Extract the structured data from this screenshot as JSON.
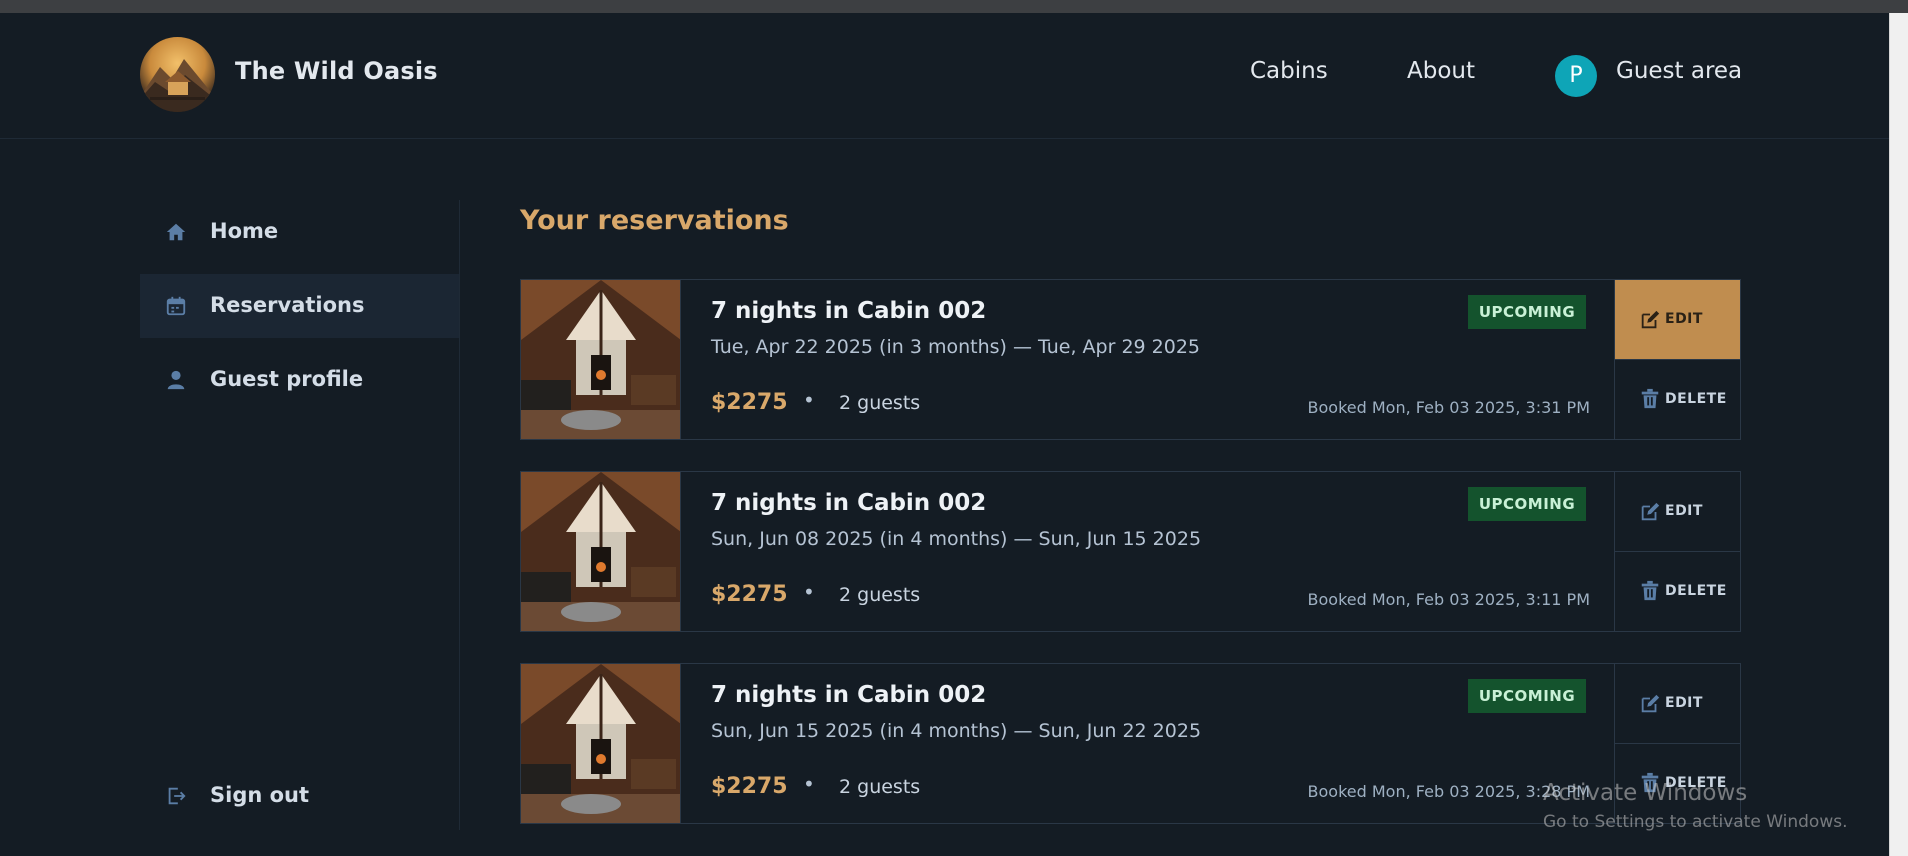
{
  "header": {
    "brand": "The Wild Oasis",
    "nav": {
      "cabins": "Cabins",
      "about": "About",
      "guest_area": "Guest area"
    },
    "avatar_initial": "P"
  },
  "sidebar": {
    "items": [
      {
        "label": "Home",
        "icon": "home-icon"
      },
      {
        "label": "Reservations",
        "icon": "calendar-icon",
        "active": true
      },
      {
        "label": "Guest profile",
        "icon": "user-icon"
      }
    ],
    "sign_out": {
      "label": "Sign out",
      "icon": "sign-out-icon"
    }
  },
  "main": {
    "title": "Your reservations",
    "reservations": [
      {
        "title": "7 nights in Cabin 002",
        "dates": "Tue, Apr 22 2025 (in 3 months) — Tue, Apr 29 2025",
        "price": "$2275",
        "separator": "•",
        "guests": "2 guests",
        "booked": "Booked Mon, Feb 03 2025, 3:31 PM",
        "status": "UPCOMING",
        "edit_label": "EDIT",
        "delete_label": "DELETE"
      },
      {
        "title": "7 nights in Cabin 002",
        "dates": "Sun, Jun 08 2025 (in 4 months) — Sun, Jun 15 2025",
        "price": "$2275",
        "separator": "•",
        "guests": "2 guests",
        "booked": "Booked Mon, Feb 03 2025, 3:11 PM",
        "status": "UPCOMING",
        "edit_label": "EDIT",
        "delete_label": "DELETE"
      },
      {
        "title": "7 nights in Cabin 002",
        "dates": "Sun, Jun 15 2025 (in 4 months) — Sun, Jun 22 2025",
        "price": "$2275",
        "separator": "•",
        "guests": "2 guests",
        "booked": "Booked Mon, Feb 03 2025, 3:28 PM",
        "status": "UPCOMING",
        "edit_label": "EDIT",
        "delete_label": "DELETE"
      }
    ]
  },
  "watermark": {
    "line1": "Activate Windows",
    "line2": "Go to Settings to activate Windows."
  },
  "colors": {
    "background": "#141c24",
    "accent": "#d9a86a",
    "badge_upcoming": "#14532d",
    "edit_highlight": "#c08d4f"
  }
}
